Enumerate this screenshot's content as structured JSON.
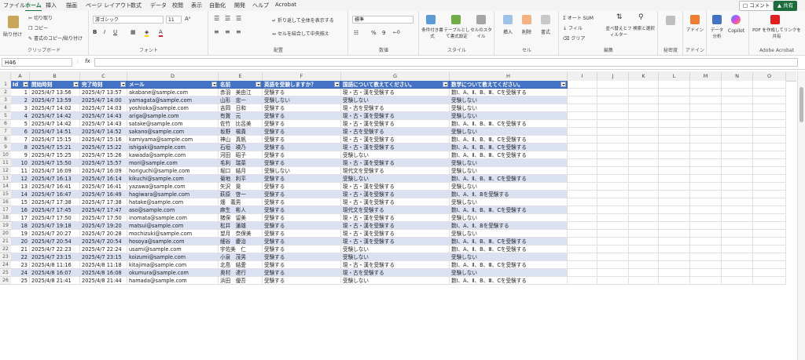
{
  "tabs": [
    "ファイル",
    "ホーム",
    "挿入",
    "描画",
    "ページ レイアウト",
    "数式",
    "データ",
    "校閲",
    "表示",
    "自動化",
    "開発",
    "ヘルプ",
    "Acrobat"
  ],
  "active_tab": "ホーム",
  "top_buttons": {
    "comment": "コメント",
    "share": "共有"
  },
  "ribbon": {
    "clipboard": {
      "paste": "貼り付け",
      "cut": "切り取り",
      "copy": "コピー",
      "format_painter": "書式のコピー/貼り付け",
      "label": "クリップボード"
    },
    "font": {
      "name": "游ゴシック",
      "size": "11",
      "label": "フォント"
    },
    "alignment": {
      "wrap": "折り返して全体を表示する",
      "merge": "セルを結合して中央揃え",
      "label": "配置"
    },
    "number": {
      "format": "標準",
      "label": "数値"
    },
    "styles": {
      "conditional": "条件付き書式",
      "table": "テーブルとして書式設定",
      "cell": "セルのスタイル",
      "label": "スタイル"
    },
    "cells": {
      "insert": "挿入",
      "delete": "削除",
      "format": "書式",
      "label": "セル"
    },
    "editing": {
      "autosum": "オート SUM",
      "fill": "フィル",
      "clear": "クリア",
      "sort": "並べ替えとフィルター",
      "find": "検索と選択",
      "label": "編集"
    },
    "sensitivity": {
      "label": "秘密度"
    },
    "addins": {
      "addin": "アドイン",
      "label": "アドイン"
    },
    "analysis": {
      "data": "データ分析"
    },
    "copilot": "Copilot",
    "acrobat": {
      "pdf": "PDF を作成してリンクを共有",
      "label": "Adobe Acrobat"
    }
  },
  "formula_bar": {
    "name_box": "H46",
    "fx": "fx"
  },
  "columns": [
    "A",
    "B",
    "C",
    "D",
    "E",
    "F",
    "G",
    "H",
    "I",
    "J",
    "K",
    "L",
    "M",
    "N",
    "O"
  ],
  "header_row": [
    "Id",
    "開始時刻",
    "完了時刻",
    "メール",
    "名前",
    "英語を受験しますか？",
    "国語について教えてください。",
    "数学について教えてください。"
  ],
  "rows": [
    [
      "1",
      "2025/4/7 13:56",
      "2025/4/7 13:57",
      "akabane@sample.com",
      "赤羽　美由江",
      "受験する",
      "現・古・漢を受験する",
      "数Ⅰ、A、Ⅱ、B、Ⅲ、Cを受験する"
    ],
    [
      "2",
      "2025/4/7 13:59",
      "2025/4/7 14:00",
      "yamagata@sample.com",
      "山形　忠一",
      "受験しない",
      "受験しない",
      "受験しない"
    ],
    [
      "3",
      "2025/4/7 14:02",
      "2025/4/7 14:03",
      "yoshioka@sample.com",
      "吉岡　日和",
      "受験する",
      "現・古を受験する",
      "受験しない"
    ],
    [
      "4",
      "2025/4/7 14:42",
      "2025/4/7 14:43",
      "ariga@sample.com",
      "有賀　元",
      "受験する",
      "現・古・漢を受験する",
      "受験しない"
    ],
    [
      "5",
      "2025/4/7 14:42",
      "2025/4/7 14:43",
      "satake@sample.com",
      "佐竹　比呂美",
      "受験する",
      "現・古・漢を受験する",
      "数Ⅰ、A、Ⅱ、B、Ⅲ、Cを受験する"
    ],
    [
      "6",
      "2025/4/7 14:51",
      "2025/4/7 14:52",
      "sakano@sample.com",
      "坂野　楊貴",
      "受験する",
      "現・古を受験する",
      "受験しない"
    ],
    [
      "7",
      "2025/4/7 15:15",
      "2025/4/7 15:16",
      "kamiyama@sample.com",
      "神山　真帆",
      "受験する",
      "現・古・漢を受験する",
      "数Ⅰ、A、Ⅱ、B、Ⅲ、Cを受験する"
    ],
    [
      "8",
      "2025/4/7 15:21",
      "2025/4/7 15:22",
      "ishigaki@sample.com",
      "石垣　瑛乃",
      "受験する",
      "現・古・漢を受験する",
      "数Ⅰ、A、Ⅱ、B、Ⅲ、Cを受験する"
    ],
    [
      "9",
      "2025/4/7 15:25",
      "2025/4/7 15:26",
      "kawada@sample.com",
      "河田　昭子",
      "受験する",
      "受験しない",
      "数Ⅰ、A、Ⅱ、B、Ⅲ、Cを受験する"
    ],
    [
      "10",
      "2025/4/7 15:50",
      "2025/4/7 15:57",
      "mori@sample.com",
      "毛利　瑞菜",
      "受験する",
      "現・古・漢を受験する",
      "受験しない"
    ],
    [
      "11",
      "2025/4/7 16:09",
      "2025/4/7 16:09",
      "horiguchi@sample.com",
      "堀口　結月",
      "受験しない",
      "現代文を受験する",
      "受験しない"
    ],
    [
      "12",
      "2025/4/7 16:13",
      "2025/4/7 16:14",
      "kikuchi@sample.com",
      "菊地　利平",
      "受験する",
      "受験しない",
      "数Ⅰ、A、Ⅱ、B、Ⅲ、Cを受験する"
    ],
    [
      "13",
      "2025/4/7 16:41",
      "2025/4/7 16:41",
      "yazawa@sample.com",
      "矢沢　晃",
      "受験する",
      "現・古・漢を受験する",
      "受験しない"
    ],
    [
      "14",
      "2025/4/7 16:47",
      "2025/4/7 16:49",
      "hagiwara@sample.com",
      "萩原　啓一",
      "受験する",
      "現・古・漢を受験する",
      "数Ⅰ、A、Ⅱ、Bを受験する"
    ],
    [
      "15",
      "2025/4/7 17:38",
      "2025/4/7 17:38",
      "hatake@sample.com",
      "畑　義男",
      "受験する",
      "現・古・漢を受験する",
      "受験しない"
    ],
    [
      "16",
      "2025/4/7 17:45",
      "2025/4/7 17:47",
      "aso@sample.com",
      "麻生　彬人",
      "受験する",
      "現代文を受験する",
      "数Ⅰ、A、Ⅱ、B、Ⅲ、Cを受験する"
    ],
    [
      "17",
      "2025/4/7 17:50",
      "2025/4/7 17:50",
      "inomata@sample.com",
      "猪俣　留美",
      "受験する",
      "現・古・漢を受験する",
      "受験しない"
    ],
    [
      "18",
      "2025/4/7 19:18",
      "2025/4/7 19:20",
      "matsui@sample.com",
      "松井　蓮雄",
      "受験する",
      "現・古・漢を受験する",
      "数Ⅰ、A、Ⅱ、Bを受験する"
    ],
    [
      "19",
      "2025/4/7 20:27",
      "2025/4/7 20:28",
      "mochizuki@sample.com",
      "望月　奈保美",
      "受験する",
      "現・古・漢を受験する",
      "受験しない"
    ],
    [
      "20",
      "2025/4/7 20:54",
      "2025/4/7 20:54",
      "hosoya@sample.com",
      "細谷　慶治",
      "受験する",
      "現・古・漢を受験する",
      "数Ⅰ、A、Ⅱ、B、Ⅲ、Cを受験する"
    ],
    [
      "21",
      "2025/4/7 22:23",
      "2025/4/7 22:24",
      "usami@sample.com",
      "宇佐美　仁",
      "受験する",
      "受験しない",
      "数Ⅰ、A、Ⅱ、B、Ⅲ、Cを受験する"
    ],
    [
      "22",
      "2025/4/7 23:15",
      "2025/4/7 23:15",
      "koizumi@sample.com",
      "小泉　茂男",
      "受験する",
      "受験しない",
      "受験しない"
    ],
    [
      "23",
      "2025/4/8 11:16",
      "2025/4/8 11:18",
      "kitajima@sample.com",
      "北島　結愛",
      "受験する",
      "現・古・漢を受験する",
      "数Ⅰ、A、Ⅱ、B、Ⅲ、Cを受験する"
    ],
    [
      "24",
      "2025/4/8 16:07",
      "2025/4/8 16:08",
      "okumura@sample.com",
      "奥村　達行",
      "受験する",
      "現・古を受験する",
      "受験しない"
    ],
    [
      "25",
      "2025/4/8 21:41",
      "2025/4/8 21:44",
      "hamada@sample.com",
      "浜田　優吾",
      "受験する",
      "受験しない",
      "数Ⅰ、A、Ⅱ、B、Ⅲ、Cを受験する"
    ]
  ],
  "colors": {
    "header_blue": "#4472c4",
    "band": "#d9e1f2",
    "accent_green": "#1b6e3c"
  }
}
